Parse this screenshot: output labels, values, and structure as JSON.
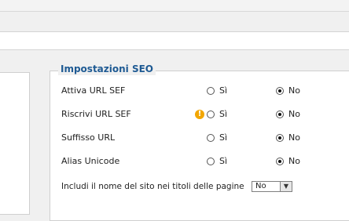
{
  "seo": {
    "title": "Impostazioni SEO",
    "rows": [
      {
        "label": "Attiva URL SEF",
        "yes": "Sì",
        "no": "No"
      },
      {
        "label": "Riscrivi URL SEF",
        "yes": "Sì",
        "no": "No"
      },
      {
        "label": "Suffisso URL",
        "yes": "Sì",
        "no": "No"
      },
      {
        "label": "Alias Unicode",
        "yes": "Sì",
        "no": "No"
      }
    ],
    "site_name_label": "Includi il nome del sito nei titoli delle pagine",
    "site_name_value": "No"
  }
}
